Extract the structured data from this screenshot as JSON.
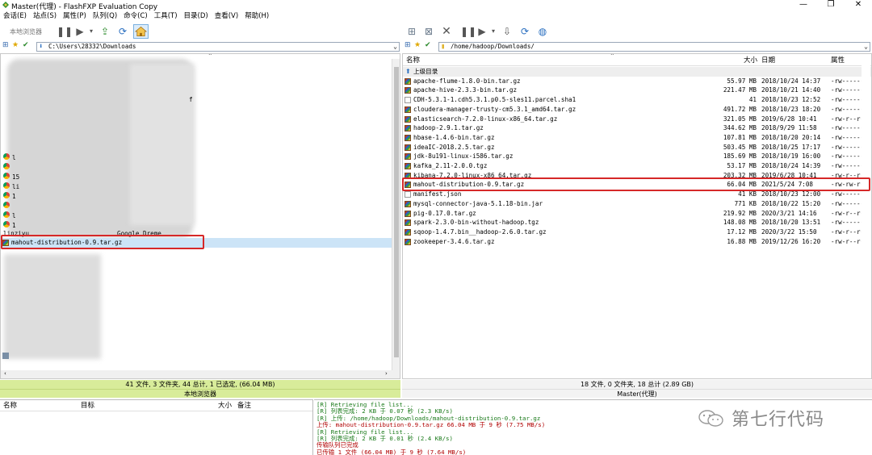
{
  "window": {
    "title": "Master(代理) - FlashFXP Evaluation Copy",
    "controls": [
      "—",
      "❐",
      "✕"
    ]
  },
  "menu": [
    "会话(E)",
    "站点(S)",
    "属性(P)",
    "队列(Q)",
    "命令(C)",
    "工具(T)",
    "目录(D)",
    "查看(V)",
    "帮助(H)"
  ],
  "left": {
    "browser_label": "本地浏览器",
    "path": "C:\\Users\\28332\\Downloads",
    "visible_fragments": {
      "f1": "f",
      "i1": "l",
      "i2": "15",
      "i3": "li",
      "i4": "1",
      "i5": "l",
      "i6": "1",
      "linziyu": "linziyu",
      "google": "Google Dreme"
    },
    "selected_file": "mahout-distribution-0.9.tar.gz",
    "status": "41 文件, 3 文件夹, 44 总计, 1 已选定, (66.04 MB)",
    "status2": "本地浏览器"
  },
  "right": {
    "path": "/home/hadoop/Downloads/",
    "columns": {
      "name": "名称",
      "size": "大小",
      "date": "日期",
      "attr": "属性"
    },
    "parent_dir": "上级目录",
    "files": [
      {
        "name": "apache-flume-1.8.0-bin.tar.gz",
        "size": "55.97 MB",
        "date": "2018/10/24 14:37",
        "attr": "-rw-------",
        "icon": "archive"
      },
      {
        "name": "apache-hive-2.3.3-bin.tar.gz",
        "size": "221.47 MB",
        "date": "2018/10/21 14:40",
        "attr": "-rw-------",
        "icon": "archive"
      },
      {
        "name": "CDH-5.3.1-1.cdh5.3.1.p0.5-sles11.parcel.sha1",
        "size": "41",
        "date": "2018/10/23 12:52",
        "attr": "-rw-------",
        "icon": "doc"
      },
      {
        "name": "cloudera-manager-trusty-cm5.3.1_amd64.tar.gz",
        "size": "491.72 MB",
        "date": "2018/10/23 18:20",
        "attr": "-rw-------",
        "icon": "archive"
      },
      {
        "name": "elasticsearch-7.2.0-linux-x86_64.tar.gz",
        "size": "321.05 MB",
        "date": "2019/6/28 10:41",
        "attr": "-rw-r--r--",
        "icon": "archive"
      },
      {
        "name": "hadoop-2.9.1.tar.gz",
        "size": "344.62 MB",
        "date": "2018/9/29 11:58",
        "attr": "-rw-------",
        "icon": "archive"
      },
      {
        "name": "hbase-1.4.6-bin.tar.gz",
        "size": "107.81 MB",
        "date": "2018/10/20 20:14",
        "attr": "-rw-------",
        "icon": "archive"
      },
      {
        "name": "ideaIC-2018.2.5.tar.gz",
        "size": "503.45 MB",
        "date": "2018/10/25 17:17",
        "attr": "-rw-------",
        "icon": "archive"
      },
      {
        "name": "jdk-8u191-linux-i586.tar.gz",
        "size": "185.69 MB",
        "date": "2018/10/19 16:00",
        "attr": "-rw-------",
        "icon": "archive"
      },
      {
        "name": "kafka_2.11-2.0.0.tgz",
        "size": "53.17 MB",
        "date": "2018/10/24 14:39",
        "attr": "-rw-------",
        "icon": "archive"
      },
      {
        "name": "kibana-7.2.0-linux-x86_64.tar.gz",
        "size": "203.32 MB",
        "date": "2019/6/28 10:41",
        "attr": "-rw-r--r--",
        "icon": "archive"
      },
      {
        "name": "mahout-distribution-0.9.tar.gz",
        "size": "66.04 MB",
        "date": "2021/5/24 7:08",
        "attr": "-rw-rw-r--",
        "icon": "archive"
      },
      {
        "name": "manifest.json",
        "size": "41 KB",
        "date": "2018/10/23 12:00",
        "attr": "-rw-------",
        "icon": "doc"
      },
      {
        "name": "mysql-connector-java-5.1.18-bin.jar",
        "size": "771 KB",
        "date": "2018/10/22 15:20",
        "attr": "-rw-------",
        "icon": "archive"
      },
      {
        "name": "pig-0.17.0.tar.gz",
        "size": "219.92 MB",
        "date": "2020/3/21 14:16",
        "attr": "-rw-r--r--",
        "icon": "archive"
      },
      {
        "name": "spark-2.3.0-bin-without-hadoop.tgz",
        "size": "148.08 MB",
        "date": "2018/10/20 13:51",
        "attr": "-rw-------",
        "icon": "archive"
      },
      {
        "name": "sqoop-1.4.7.bin__hadoop-2.6.0.tar.gz",
        "size": "17.12 MB",
        "date": "2020/3/22 15:50",
        "attr": "-rw-r--r--",
        "icon": "archive"
      },
      {
        "name": "zookeeper-3.4.6.tar.gz",
        "size": "16.88 MB",
        "date": "2019/12/26 16:20",
        "attr": "-rw-r--r--",
        "icon": "archive"
      }
    ],
    "status": "18 文件, 0 文件夹, 18 总计 (2.89 GB)",
    "status2": "Master(代理)"
  },
  "queue": {
    "columns": {
      "name": "名称",
      "target": "目标",
      "size": "大小",
      "note": "备注"
    }
  },
  "log": [
    {
      "text": "[R] Retrieving file list...",
      "color": "#1a7a1a"
    },
    {
      "text": "[R] 列表完成: 2 KB 于 0.07 秒 (2.3 KB/s)",
      "color": "#1a7a1a"
    },
    {
      "text": "[R] 上传: /home/hadoop/Downloads/mahout-distribution-0.9.tar.gz",
      "color": "#1a7a1a"
    },
    {
      "text": "上传: mahout-distribution-0.9.tar.gz 66.04 MB 于 9 秒 (7.75 MB/s)",
      "color": "#b00000"
    },
    {
      "text": "[R] Retrieving file list...",
      "color": "#1a7a1a"
    },
    {
      "text": "[R] 列表完成: 2 KB 于 0.01 秒 (2.4 KB/s)",
      "color": "#1a7a1a"
    },
    {
      "text": "传输队列已完成",
      "color": "#b00000"
    },
    {
      "text": "已传输 1 文件 (66.04 MB) 于 9 秒 (7.64 MB/s)",
      "color": "#b00000"
    }
  ],
  "watermark": "第七行代码",
  "colors": {
    "status_bg": "#d8ec9a",
    "selected_bg": "#cce4f7",
    "red": "#d62828"
  }
}
